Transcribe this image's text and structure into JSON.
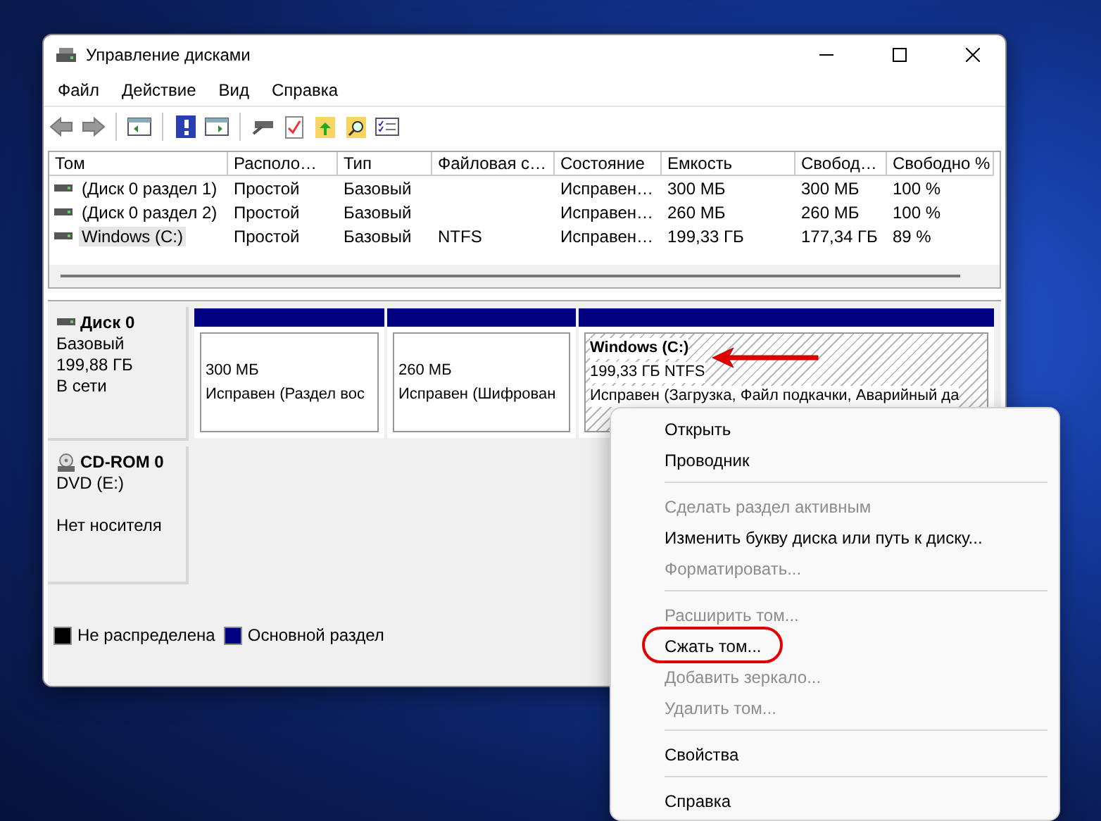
{
  "window": {
    "title": "Управление дисками"
  },
  "menu_bar": [
    "Файл",
    "Действие",
    "Вид",
    "Справка"
  ],
  "table": {
    "columns": [
      "Том",
      "Располо…",
      "Тип",
      "Файловая с…",
      "Состояние",
      "Емкость",
      "Свобод…",
      "Свободно %"
    ],
    "rows": [
      {
        "cells": [
          "(Диск 0 раздел 1)",
          "Простой",
          "Базовый",
          "",
          "Исправен…",
          "300 МБ",
          "300 МБ",
          "100 %"
        ],
        "selected": false
      },
      {
        "cells": [
          "(Диск 0 раздел 2)",
          "Простой",
          "Базовый",
          "",
          "Исправен…",
          "260 МБ",
          "260 МБ",
          "100 %"
        ],
        "selected": false
      },
      {
        "cells": [
          "Windows (C:)",
          "Простой",
          "Базовый",
          "NTFS",
          "Исправен…",
          "199,33 ГБ",
          "177,34 ГБ",
          "89 %"
        ],
        "selected": true
      }
    ]
  },
  "disks": [
    {
      "kind": "hdd",
      "name": "Диск 0",
      "lines": [
        "Базовый",
        "199,88 ГБ"
      ],
      "status": "В сети",
      "partitions": [
        {
          "size": "300 МБ",
          "status": "Исправен (Раздел вос",
          "selected": false,
          "arrow": false
        },
        {
          "size": "260 МБ",
          "status": "Исправен (Шифрован",
          "selected": false,
          "arrow": false
        },
        {
          "label": "Windows  (C:)",
          "size": "199,33 ГБ NTFS",
          "status": "Исправен (Загрузка, Файл подкачки, Аварийный да",
          "selected": true,
          "arrow": true
        }
      ]
    },
    {
      "kind": "cdrom",
      "name": "CD-ROM 0",
      "lines": [
        "DVD (E:)"
      ],
      "status": "Нет носителя"
    }
  ],
  "legend": [
    {
      "label": "Не распределена",
      "color": "#000000"
    },
    {
      "label": "Основной раздел",
      "color": "#000080"
    }
  ],
  "context_menu": [
    {
      "kind": "item",
      "label": "Открыть",
      "disabled": false,
      "circled": false
    },
    {
      "kind": "item",
      "label": "Проводник",
      "disabled": false,
      "circled": false
    },
    {
      "kind": "separator"
    },
    {
      "kind": "item",
      "label": "Сделать раздел активным",
      "disabled": true,
      "circled": false
    },
    {
      "kind": "item",
      "label": "Изменить букву диска или путь к диску...",
      "disabled": false,
      "circled": false
    },
    {
      "kind": "item",
      "label": "Форматировать...",
      "disabled": true,
      "circled": false
    },
    {
      "kind": "separator"
    },
    {
      "kind": "item",
      "label": "Расширить том...",
      "disabled": true,
      "circled": false
    },
    {
      "kind": "item",
      "label": "Сжать том...",
      "disabled": false,
      "circled": true
    },
    {
      "kind": "item",
      "label": "Добавить зеркало...",
      "disabled": true,
      "circled": false
    },
    {
      "kind": "item",
      "label": "Удалить том...",
      "disabled": true,
      "circled": false
    },
    {
      "kind": "separator"
    },
    {
      "kind": "item",
      "label": "Свойства",
      "disabled": false,
      "circled": false
    },
    {
      "kind": "separator"
    },
    {
      "kind": "item",
      "label": "Справка",
      "disabled": false,
      "circled": false
    }
  ]
}
